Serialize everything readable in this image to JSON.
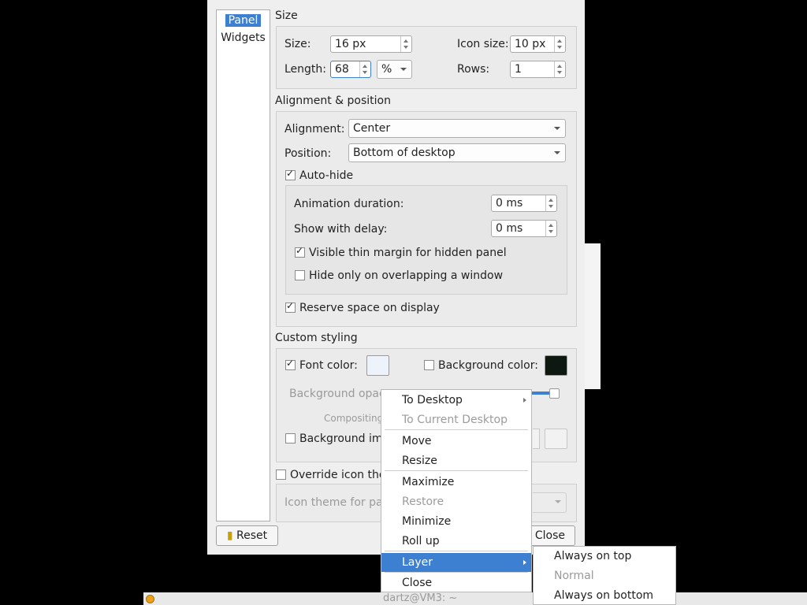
{
  "nav": {
    "panel": "Panel",
    "widgets": "Widgets"
  },
  "size_group": {
    "title": "Size",
    "size_label": "Size:",
    "size_value": "16 px",
    "icon_size_label": "Icon size:",
    "icon_size_value": "10 px",
    "length_label": "Length:",
    "length_value": "68",
    "length_unit": "%",
    "rows_label": "Rows:",
    "rows_value": "1"
  },
  "alignment_group": {
    "title": "Alignment & position",
    "alignment_label": "Alignment:",
    "alignment_value": "Center",
    "position_label": "Position:",
    "position_value": "Bottom of desktop",
    "autohide_label": "Auto-hide",
    "autohide_checked": true,
    "animation_label": "Animation duration:",
    "animation_value": "0 ms",
    "delay_label": "Show with delay:",
    "delay_value": "0 ms",
    "thin_margin_label": "Visible thin margin for hidden panel",
    "thin_margin_checked": true,
    "overlap_label": "Hide only on overlapping a window",
    "overlap_checked": false,
    "reserve_label": "Reserve space on display",
    "reserve_checked": true
  },
  "styling_group": {
    "title": "Custom styling",
    "font_color_label": "Font color:",
    "font_color_checked": true,
    "font_color": "#eef3fb",
    "bg_color_label": "Background color:",
    "bg_color_checked": false,
    "bg_color": "#0c1810",
    "bg_opacity_label": "Background opac",
    "compositing_label": "Compositing",
    "bg_image_label": "Background im"
  },
  "icon_theme": {
    "override_label": "Override icon the",
    "theme_label": "Icon theme for pa"
  },
  "buttons": {
    "reset": "Reset",
    "close": "Close"
  },
  "context_menu": {
    "items": [
      {
        "label": "To Desktop",
        "mnemonic": "D"
      },
      {
        "label": "To Current Desktop",
        "mnemonic": "T"
      },
      {
        "label": "Move",
        "mnemonic": "M"
      },
      {
        "label": "Resize",
        "mnemonic": "z"
      },
      {
        "label": "Maximize",
        "mnemonic": "x"
      },
      {
        "label": "Restore",
        "mnemonic": "R"
      },
      {
        "label": "Minimize",
        "mnemonic": "n"
      },
      {
        "label": "Roll up",
        "mnemonic": "u"
      },
      {
        "label": "Layer",
        "mnemonic": "L"
      },
      {
        "label": "Close",
        "mnemonic": "C"
      }
    ]
  },
  "layer_submenu": {
    "items": [
      {
        "label": "Always on top",
        "mnemonic": "t"
      },
      {
        "label": "Normal",
        "mnemonic": "N"
      },
      {
        "label": "Always on bottom",
        "mnemonic": "b"
      }
    ]
  },
  "taskbar": {
    "window_title": "dartz@VM3: ~"
  },
  "colors": {
    "accent": "#3d7fd1",
    "dialog_bg": "#efefef"
  }
}
